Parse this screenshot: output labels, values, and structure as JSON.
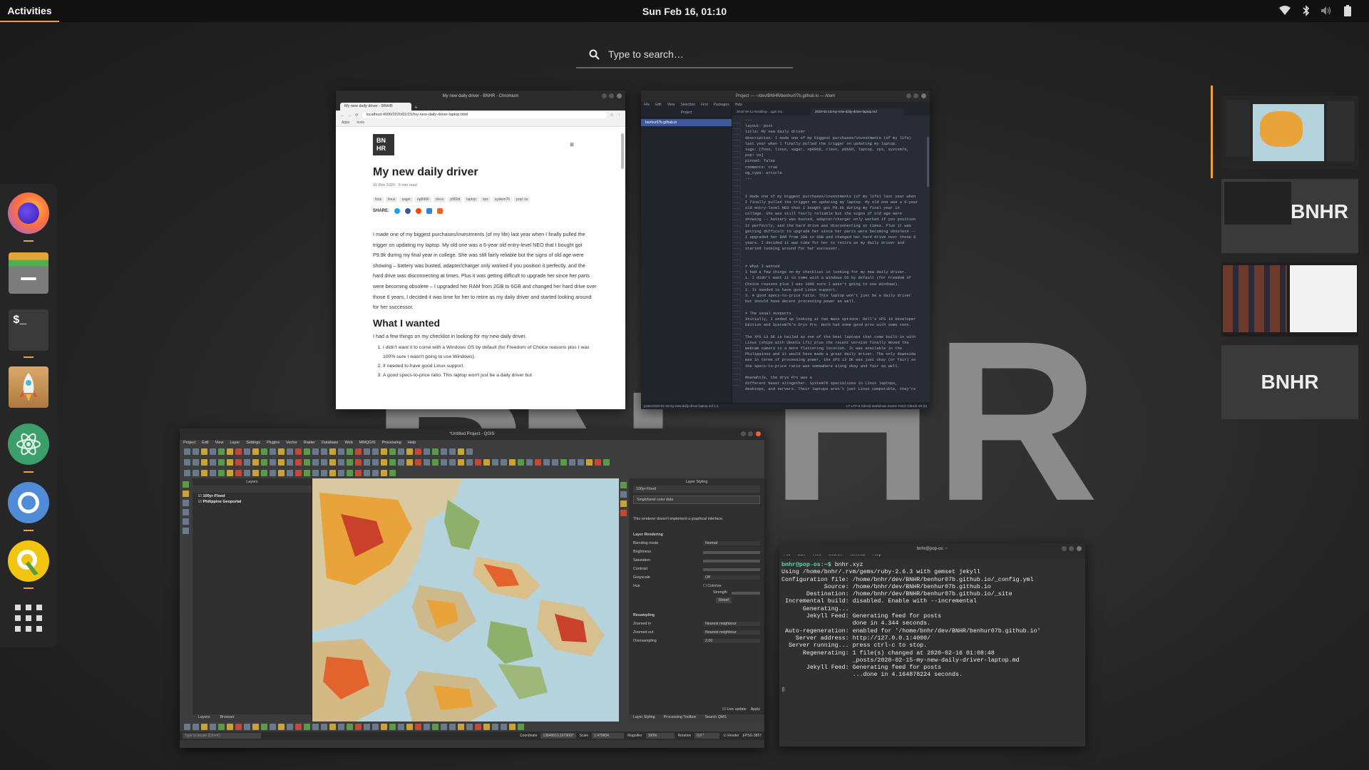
{
  "topbar": {
    "activities": "Activities",
    "clock": "Sun Feb 16, 01:10",
    "tray_icons": [
      "wifi-icon",
      "bluetooth-icon",
      "volume-icon",
      "battery-icon"
    ]
  },
  "search": {
    "placeholder": "Type to search…"
  },
  "dock": {
    "apps": [
      {
        "name": "firefox",
        "running": true
      },
      {
        "name": "files",
        "running": false
      },
      {
        "name": "terminal",
        "running": true
      },
      {
        "name": "pop-shop",
        "running": false
      },
      {
        "name": "atom",
        "running": true
      },
      {
        "name": "chromium",
        "running": true
      },
      {
        "name": "qgis",
        "running": true
      },
      {
        "name": "show-applications",
        "running": false
      }
    ]
  },
  "wallpaper": {
    "letters": [
      "B",
      "N",
      "H",
      "R"
    ]
  },
  "browser": {
    "window_title": "My new daily driver - BNHR - Chromium",
    "tab_title": "My new daily driver - BNHR",
    "url": "localhost:4000/2020/02/15/my-new-daily-driver-laptop.html",
    "bookmarks": [
      "Apps",
      "tools"
    ],
    "logo": "BN\nHR",
    "post_title": "My new daily driver",
    "meta": "15 Feb 2020 · 5 min read",
    "tags": [
      "foss",
      "linux",
      "sager",
      "np8966",
      "clevo",
      "p960d",
      "laptop",
      "xps",
      "system76",
      "pop! os"
    ],
    "share": "SHARE:",
    "intro": "I made one of my biggest purchases/investments (of my life) last year when I finally pulled the trigger on updating my laptop. My old one was a 6-year old entry-level NEO that I bought got P9.9k during my final year in college. She was still fairly reliable but the signs of old age were showing – battery was busted, adapter/charger only worked if you position it perfectly, and the hard drive was disconnecting at times. Plus it was getting difficult to upgrade her since her parts were becoming obsolete – I upgraded her RAM from 2GB to 6GB and changed her hard drive over those 6 years. I decided it was time for her to retire as my daily driver and started looking around for her successor.",
    "h2": "What I wanted",
    "p2": "I had a few things on my checklist in looking for my new daily driver.",
    "list": [
      "I didn't want it to come with a Windows OS by default (for Freedom of Choice reasons plus I was 100% sure I wasn't going to use Windows).",
      "It needed to have good Linux support.",
      "A good specs-to-price ratio. This laptop won't just be a daily driver but"
    ]
  },
  "atom": {
    "window_title": "Project — ~/dev/BNHR/benhur07b.github.io — Atom",
    "menu": [
      "File",
      "Edit",
      "View",
      "Selection",
      "Find",
      "Packages",
      "Help"
    ],
    "panel_title": "Project",
    "tabs": [
      "2016-08-11-installing-...qgis.md",
      "2020-02-15-my-new-daily-driver-laptop.md"
    ],
    "tree_item": "benhur07b.github.io",
    "code": "---\nlayout: post\ntitle: My new daily driver\ndescription: I made one of my biggest purchases/investments (of my life)\nlast year when I finally pulled the trigger on updating my laptop.\ntags: [foss, linux, sager, np8966, clevo, p960d, laptop, xps, system76,\npop! os]\npinned: false\ncomments: true\nog_type: article\n---\n\n\nI made one of my biggest purchases/investments (of my life) last year when\nI finally pulled the trigger on updating my laptop. My old one was a 6-year\nold entry-level NEO that I bought got P9.9k during my final year in\ncollege. She was still fairly reliable but the signs of old age were\nshowing -- battery was busted, adapter/charger only worked if you position\nit perfectly, and the hard drive was disconnecting at times. Plus it was\ngetting difficult to upgrade her since her parts were becoming obsolete --\nI upgraded her RAM from 2GB to 6GB and changed her hard drive over those 6\nyears. I decided it was time for her to retire as my daily driver and\nstarted looking around for her successor.\n\n\n# What I wanted\nI had a few things on my checklist in looking for my new daily driver.\n1. I didn't want it to come with a Windows OS by default (for Freedom of\nChoice reasons plus I was 100% sure I wasn't going to use Windows).\n2. It needed to have good Linux support.\n3. A good specs-to-price ratio. This laptop won't just be a daily driver\nbut should have decent processing power as well.\n\n# The usual suspects\nInitially, I ended up looking at two main options: Dell's XPS 13 Developer\nEdition and System76's Oryx Pro. Both had some good pros with some cons.\n\nThe XPS 13 DE is hailed as one of the best laptops that come built-in with\nLinux (ships with Ubuntu LTS) plus the recent version finally moved the\nwebcam camera to a more flattering location. It was available in the\nPhilippines and it would have made a great daily driver. The only downside\nwas in terms of processing power, the XPS 13 DE was just okay (or fair) so\nthe specs-to-price ratio was somewhere along okay and fair as well.\n\nMeanwhile, the Oryx Pro was a\ndifferent beast altogether. System76 specializes in Linux laptops,\ndesktops, and servers. Their laptops aren't just Linux compatible, they're\nactually built to run Linux by default. They ship with Ubuntu or Pop! OS\n(System76's own OS). The specs-to-price ratio was also great. For the same\namount, the Oryx Pro's configuration had more to offer than the XPS 13 DE.\nThe downside was System76 was based in the US. If I wanted the Oryx Pro, I",
    "status_left": "posts/2020-02-15-my-new-daily-driver-laptop.md  1:1",
    "status_right": "LF  UTF-8  GitHub Markdown  master  Fetch  GitHub  Git (0)"
  },
  "qgis": {
    "window_title": "*Untitled Project - QGIS",
    "menu": [
      "Project",
      "Edit",
      "View",
      "Layer",
      "Settings",
      "Plugins",
      "Vector",
      "Raster",
      "Database",
      "Web",
      "MMQGIS",
      "Processing",
      "Help"
    ],
    "layers_title": "Layers",
    "layers": [
      "100yr-Flood",
      "Philippine Geoportal"
    ],
    "bottom_tabs_left": [
      "Layers",
      "Browser"
    ],
    "styling_title": "Layer Styling",
    "styling_layer": "100yr-Flood",
    "renderer": "Singleband color data",
    "renderer_note": "This renderer doesn't implement a graphical interface.",
    "rendering_title": "Layer Rendering",
    "rendering_rows": [
      "Blending mode",
      "Brightness",
      "Saturation",
      "Contrast",
      "Grayscale",
      "Hue"
    ],
    "blending_value": "Normal",
    "grayscale_value": "Off",
    "colorize": "Colorize",
    "strength": "Strength",
    "reset": "Reset",
    "resampling_title": "Resampling",
    "resampling_rows": [
      "Zoomed in",
      "Zoomed out",
      "Oversampling"
    ],
    "zoomed_in": "Nearest neighbour",
    "zoomed_out": "Nearest neighbour",
    "oversampling": "2.00",
    "live_update": "Live update",
    "apply": "Apply",
    "bottom_tabs_right": [
      "Layer Styling",
      "Processing Toolbox",
      "Search QMS"
    ],
    "search_placeholder": "Type to locate (Ctrl+K)",
    "coordinate_label": "Coordinate",
    "coordinate": "13840010,1679007",
    "scale_label": "Scale",
    "scale": "1:479604",
    "magnifier_label": "Magnifier",
    "magnifier": "100%",
    "rotation_label": "Rotation",
    "rotation": "0.0 °",
    "render": "Render",
    "crs": "EPSG:3857"
  },
  "terminal": {
    "title": "bnhr@pop-os: ~",
    "menu": [
      "File",
      "Edit",
      "View",
      "Search",
      "Terminal",
      "Help"
    ],
    "prompt": "bnhr@pop-os:~$",
    "command": " bnhr.xyz",
    "output": "Using /home/bnhr/.rvm/gems/ruby-2.6.3 with gemset jekyll\nConfiguration file: /home/bnhr/dev/BNHR/benhur07b.github.io/_config.yml\n            Source: /home/bnhr/dev/BNHR/benhur07b.github.io\n       Destination: /home/bnhr/dev/BNHR/benhur07b.github.io/_site\n Incremental build: disabled. Enable with --incremental\n      Generating...\n       Jekyll Feed: Generating feed for posts\n                    done in 4.344 seconds.\n Auto-regeneration: enabled for '/home/bnhr/dev/BNHR/benhur07b.github.io'\n    Server address: http://127.0.0.1:4000/\n  Server running... press ctrl-c to stop.\n      Regenerating: 1 file(s) changed at 2020-02-16 01:08:48\n                    _posts/2020-02-15-my-new-daily-driver-laptop.md\n       Jekyll Feed: Generating feed for posts\n                    ...done in 4.164878224 seconds.",
    "cursor": "▯"
  },
  "workspaces": {
    "items": [
      "workspace-1",
      "workspace-2",
      "workspace-3",
      "workspace-4"
    ],
    "label": "BNHR",
    "active": 0
  },
  "colors": {
    "accent": "#e8a33d",
    "panel": "#111111",
    "dock": "#262626"
  }
}
